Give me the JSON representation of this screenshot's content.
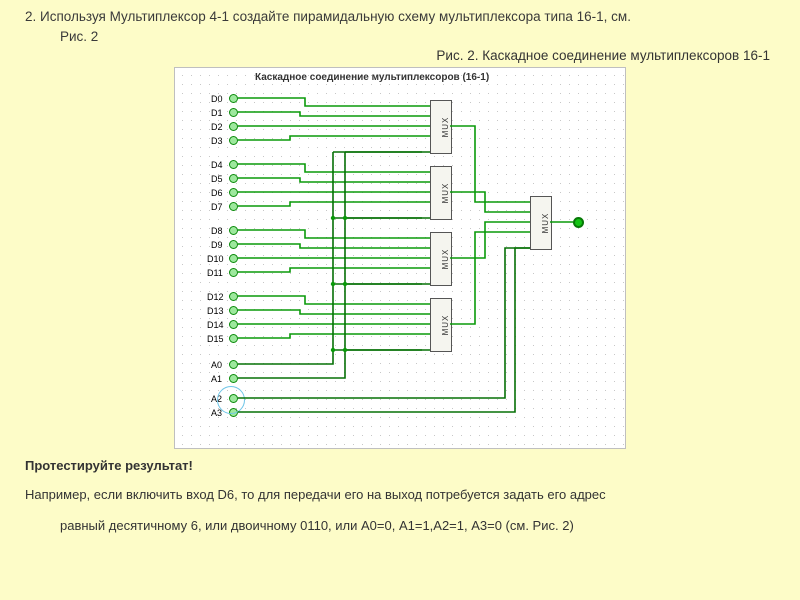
{
  "task": {
    "num": "2.",
    "line1": "Используя Мультиплексор 4-1 создайте пирамидальную схему мультиплексора типа 16-1, см.",
    "line2": "Рис. 2"
  },
  "caption": "Рис. 2. Каскадное соединение мультиплексоров 16-1",
  "diagram": {
    "title": "Каскадное соединение мультиплексоров (16-1)",
    "inputs": [
      "D0",
      "D1",
      "D2",
      "D3",
      "D4",
      "D5",
      "D6",
      "D7",
      "D8",
      "D9",
      "D10",
      "D11",
      "D12",
      "D13",
      "D14",
      "D15"
    ],
    "addr": [
      "A0",
      "A1",
      "A2",
      "A3"
    ],
    "mux_label": "MUX"
  },
  "test_heading": "Протестируйте результат!",
  "example": {
    "line1": "Например, если включить вход D6, то для передачи его на выход потребуется задать его адрес",
    "line2": "равный десятичному 6, или двоичному 0110, или  А0=0, А1=1,А2=1, А3=0 (см. Рис. 2)"
  }
}
